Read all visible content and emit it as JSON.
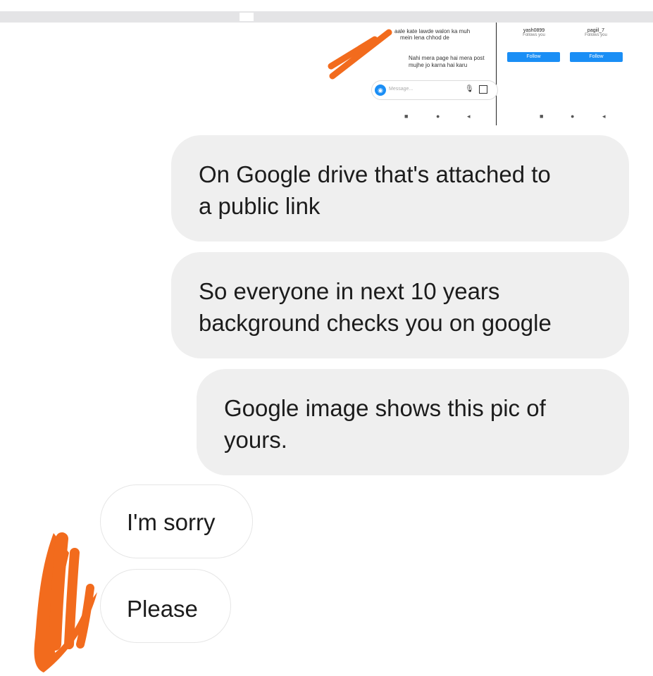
{
  "embedded_screenshot": {
    "chat_line_1": "aale kate lawde walon ka muh",
    "chat_line_2": "mein lena chhod de",
    "chat_line_3": "Nahi mera page hai mera post",
    "chat_line_4": "mujhe jo karna hai karu",
    "message_placeholder": "Message...",
    "users": [
      {
        "username": "yash0899",
        "status": "Follows you",
        "button": "Follow"
      },
      {
        "username": "pagiil_7",
        "status": "Follows you",
        "button": "Follow"
      }
    ]
  },
  "messages": [
    {
      "text_line_1": "On Google drive that's attached to",
      "text_line_2": "a public link",
      "side": "sent"
    },
    {
      "text_line_1": "So everyone in next 10 years",
      "text_line_2": "background checks you on google",
      "side": "sent"
    },
    {
      "text_line_1": "Google image shows this pic of",
      "text_line_2": "yours.",
      "side": "sent"
    },
    {
      "text_line_1": "I'm sorry",
      "side": "received"
    },
    {
      "text_line_1": "Please",
      "side": "received"
    }
  ],
  "colors": {
    "sent_bubble": "#efefef",
    "received_bubble": "#ffffff",
    "follow_button": "#1a8ef5",
    "redaction": "#f26b1d"
  },
  "icons": [
    "camera-icon",
    "microphone-icon",
    "gallery-icon",
    "nav-square-icon",
    "nav-circle-icon",
    "nav-back-icon"
  ]
}
